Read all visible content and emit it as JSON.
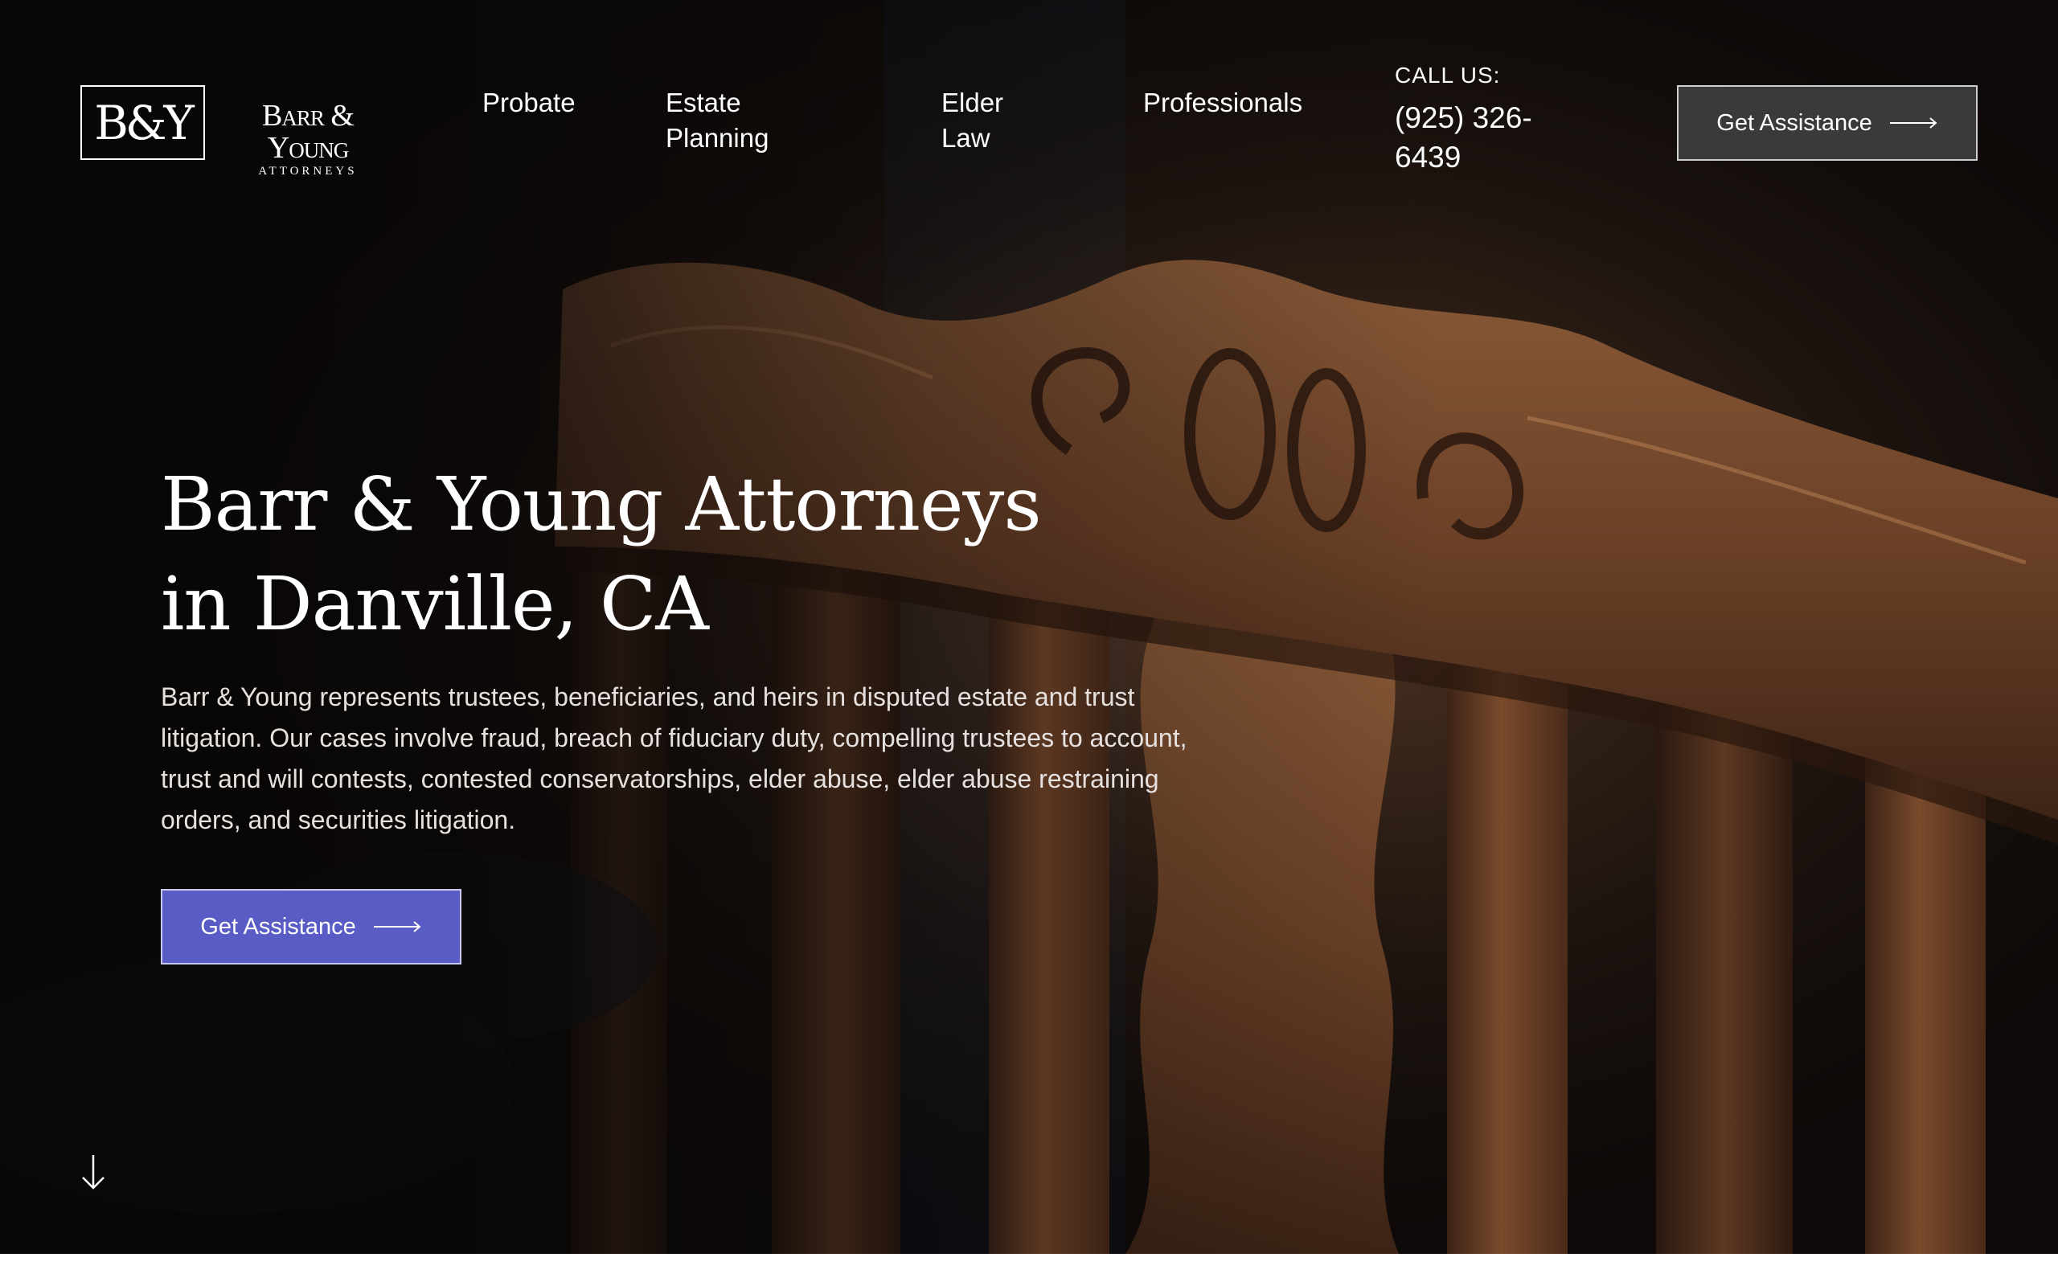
{
  "brand": {
    "monogram": "B&Y",
    "name": "Barr & Young",
    "tagline": "ATTORNEYS"
  },
  "nav": {
    "items": [
      {
        "label": "Probate"
      },
      {
        "label": "Estate Planning"
      },
      {
        "label": "Elder Law"
      },
      {
        "label": "Professionals"
      }
    ]
  },
  "contact": {
    "label": "CALL US:",
    "phone": "(925) 326-6439"
  },
  "header": {
    "cta_label": "Get Assistance"
  },
  "hero": {
    "title_line1": "Barr & Young Attorneys",
    "title_line2": "in Danville, CA",
    "description": "Barr & Young represents trustees, beneficiaries, and heirs in disputed estate and trust litigation. Our cases involve fraud, breach of fiduciary duty, compelling trustees to account, trust and will contests, contested conservatorships, elder abuse, elder abuse restraining orders, and securities litigation.",
    "cta_label": "Get Assistance"
  },
  "colors": {
    "accent": "#5a5cc6",
    "header_button": "#3a3a3a",
    "text": "#ffffff",
    "background": "#0b0807",
    "wood": "#6b4127"
  },
  "icons": {
    "cta_arrow": "long-arrow-right-icon",
    "scroll": "arrow-down-icon"
  }
}
